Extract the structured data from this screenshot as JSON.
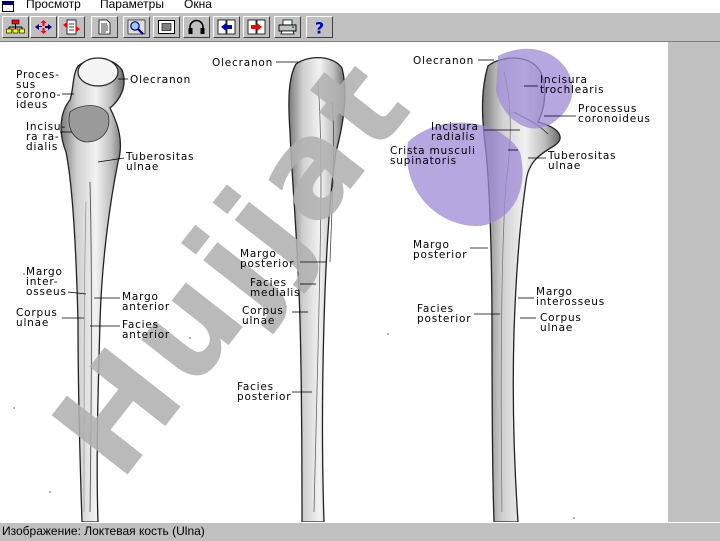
{
  "menu": {
    "items": [
      {
        "label": "Просмотр"
      },
      {
        "label": "Параметры"
      },
      {
        "label": "Окна"
      }
    ]
  },
  "toolbar": {
    "buttons": [
      {
        "icon": "hierarchy-icon"
      },
      {
        "icon": "move-arrows-icon"
      },
      {
        "icon": "document-arrows-icon"
      },
      {
        "icon": "text-document-icon"
      },
      {
        "icon": "magnify-icon"
      },
      {
        "icon": "picture-frame-icon"
      },
      {
        "icon": "headphones-icon"
      },
      {
        "icon": "previous-image-icon"
      },
      {
        "icon": "next-image-icon"
      },
      {
        "icon": "printer-icon"
      },
      {
        "icon": "help-icon"
      }
    ]
  },
  "figure": {
    "watermark_text": "Hujjat",
    "watermark_color": "#b0b0b0",
    "highlight_color": "#9f8ad8",
    "labels": {
      "l1_processus": "Proces-\nsus\ncorono-\nideus",
      "l1_olecranon": "Olecranon",
      "l1_incisura": "Incisu-\nra ra-\ndialis",
      "l1_tuberositas": "Tuberositas\nulnae",
      "l1_margo_interosseus": "Margo\ninter-\nosseus",
      "l1_margo_anterior": "Margo\nanterior",
      "l1_corpus": "Corpus\nulnae",
      "l1_facies_anterior": "Facies\nanterior",
      "l2_olecranon": "Olecranon",
      "l2_margo_posterior": "Margo\nposterior",
      "l2_facies_medialis": "Facies\nmedialis",
      "l2_corpus": "Corpus\nulnae",
      "l2_facies_posterior": "Facies\nposterior",
      "l3_olecranon": "Olecranon",
      "l3_incisura_trochlearis": "Incisura\ntrochlearis",
      "l3_processus": "Processus\ncoronoideus",
      "l3_incisura_radialis": "Incisura\nradialis",
      "l3_crista": "Crista musculi\nsupinatoris",
      "l3_tuberositas": "Tuberositas\nulnae",
      "l3_margo_posterior": "Margo\nposterior",
      "l3_margo_interosseus": "Margo\ninterosseus",
      "l3_facies_posterior": "Facies\nposterior",
      "l3_corpus": "Corpus\nulnae"
    }
  },
  "status": {
    "text": "Изображение: Локтевая кость (Ulna)"
  }
}
